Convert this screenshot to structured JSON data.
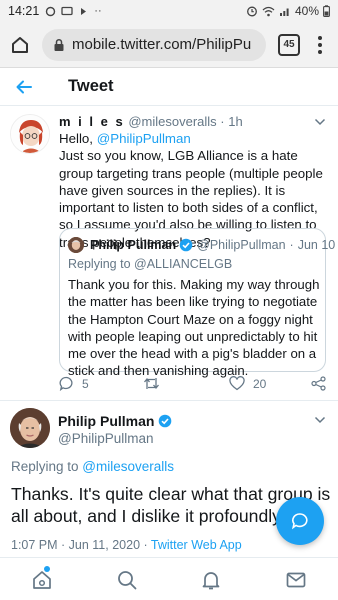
{
  "status_bar": {
    "time": "14:21",
    "battery": "40%"
  },
  "browser": {
    "url": "mobile.twitter.com/PhilipPu",
    "tab_count": "45"
  },
  "header": {
    "title": "Tweet"
  },
  "parent_tweet": {
    "name": "m i l e s",
    "handle": "@milesoveralls",
    "separator": "·",
    "time": "1h",
    "greeting_prefix": "Hello, ",
    "greeting_mention": "@PhilipPullman",
    "text": "Just so you know, LGB Alliance is a hate group targeting trans people (multiple people have given sources in the replies). It is important to listen to both sides of a conflict, so I assume you'd also be willing to listen to trans people themselves?",
    "quoted": {
      "name": "Philip Pullman",
      "handle": "@PhilipPullman",
      "separator": "·",
      "date": "Jun 10",
      "replying_to": "Replying to @ALLIANCELGB",
      "text": "Thank you for this. Making my way through the matter has been like trying to negotiate the Hampton Court Maze on a foggy night with people leaping out unpredictably to hit me over the head with a pig's bladder on a stick and then vanishing again."
    },
    "reply_count": "5",
    "like_count": "20"
  },
  "main_tweet": {
    "name": "Philip Pullman",
    "handle": "@PhilipPullman",
    "replying_prefix": "Replying to ",
    "replying_mention": "@milesoveralls",
    "text": "Thanks. It's quite clear what that group is all about, and I dislike it profoundly.",
    "timestamp": "1:07 PM · Jun 11, 2020 · ",
    "source": "Twitter Web App"
  },
  "colors": {
    "accent": "#1da1f2",
    "secondary_text": "#657786",
    "border": "#e6ecf0"
  },
  "icons": {
    "home": "home-icon",
    "search": "search-icon",
    "notifications": "bell-icon",
    "messages": "mail-icon",
    "compose": "compose-icon"
  }
}
